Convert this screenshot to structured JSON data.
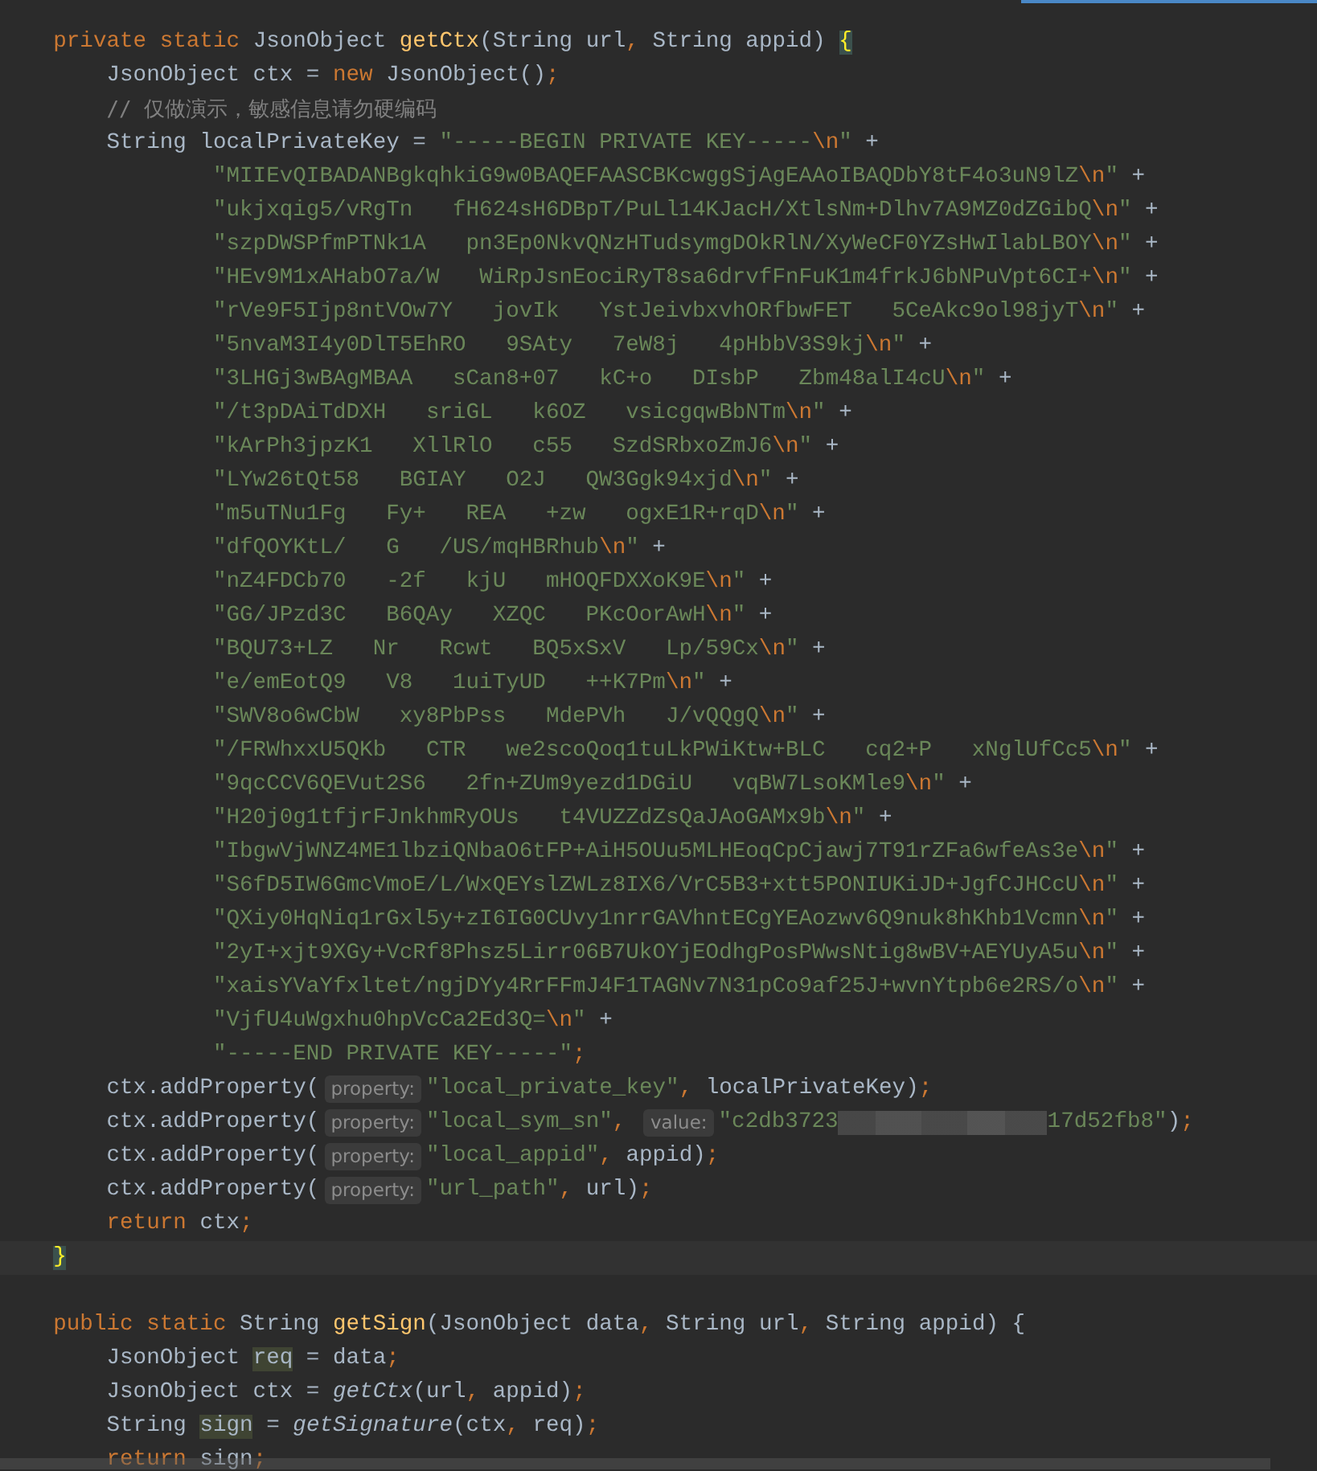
{
  "editor": {
    "lines": [
      {
        "kind": "code",
        "tokens": [
          {
            "kind": "keyword",
            "text": "private static "
          },
          {
            "kind": "plain",
            "text": "JsonObject "
          },
          {
            "kind": "method",
            "text": "getCtx"
          },
          {
            "kind": "plain",
            "text": "(String url"
          },
          {
            "kind": "punct",
            "text": ", "
          },
          {
            "kind": "plain",
            "text": "String appid) "
          },
          {
            "kind": "brace",
            "text": "{"
          }
        ],
        "children": [
          {
            "kind": "code",
            "tokens": [
              {
                "kind": "plain",
                "text": "JsonObject ctx = "
              },
              {
                "kind": "keyword",
                "text": "new "
              },
              {
                "kind": "plain",
                "text": "JsonObject()"
              },
              {
                "kind": "punct",
                "text": ";"
              }
            ]
          },
          {
            "kind": "code",
            "tokens": [
              {
                "kind": "comment",
                "text": "// 仅做演示，敏感信息请勿硬编码"
              }
            ]
          },
          {
            "kind": "code",
            "tokens": [
              {
                "kind": "plain",
                "text": "String localPrivateKey = "
              },
              {
                "kind": "string",
                "text": "\"-----BEGIN PRIVATE KEY-----"
              },
              {
                "kind": "escape",
                "text": "\\n"
              },
              {
                "kind": "string",
                "text": "\""
              },
              {
                "kind": "plain",
                "text": " +"
              }
            ],
            "continued": [
              {
                "kind": "code",
                "tokens": [
                  {
                    "kind": "string",
                    "text": "\"MIIEvQIBADANBgkqhkiG9w0BAQEFAASCBKcwggSjAgEAAoIBAQDbY8tF4o3uN9lZ"
                  },
                  {
                    "kind": "escape",
                    "text": "\\n"
                  },
                  {
                    "kind": "string",
                    "text": "\""
                  },
                  {
                    "kind": "plain",
                    "text": " +"
                  }
                ]
              },
              {
                "kind": "code",
                "tokens": [
                  {
                    "kind": "string",
                    "text": "\"ukjxqig5/vRgTn"
                  },
                  {
                    "kind": "gap"
                  },
                  {
                    "kind": "string",
                    "text": "fH624sH6DBpT/PuLl14KJacH/XtlsNm+Dlhv7A9MZ0dZGibQ"
                  },
                  {
                    "kind": "escape",
                    "text": "\\n"
                  },
                  {
                    "kind": "string",
                    "text": "\""
                  },
                  {
                    "kind": "plain",
                    "text": " +"
                  }
                ]
              },
              {
                "kind": "code",
                "tokens": [
                  {
                    "kind": "string",
                    "text": "\"szpDWSPfmPTNk1A"
                  },
                  {
                    "kind": "gap"
                  },
                  {
                    "kind": "string",
                    "text": "pn3Ep0NkvQNzHTudsymgDOkRlN/XyWeCF0YZsHwIlabLBOY"
                  },
                  {
                    "kind": "escape",
                    "text": "\\n"
                  },
                  {
                    "kind": "string",
                    "text": "\""
                  },
                  {
                    "kind": "plain",
                    "text": " +"
                  }
                ]
              },
              {
                "kind": "code",
                "tokens": [
                  {
                    "kind": "string",
                    "text": "\"HEv9M1xAHabO7a/W"
                  },
                  {
                    "kind": "gap"
                  },
                  {
                    "kind": "string",
                    "text": "WiRpJsnEociRyT8sa6drvfFnFuK1m4frkJ6bNPuVpt6CI+"
                  },
                  {
                    "kind": "escape",
                    "text": "\\n"
                  },
                  {
                    "kind": "string",
                    "text": "\""
                  },
                  {
                    "kind": "plain",
                    "text": " +"
                  }
                ]
              },
              {
                "kind": "code",
                "tokens": [
                  {
                    "kind": "string",
                    "text": "\"rVe9F5Ijp8ntVOw7Y"
                  },
                  {
                    "kind": "gap"
                  },
                  {
                    "kind": "string",
                    "text": "jovIk"
                  },
                  {
                    "kind": "gap"
                  },
                  {
                    "kind": "string",
                    "text": "YstJeivbxvhORfbwFET"
                  },
                  {
                    "kind": "gap"
                  },
                  {
                    "kind": "string",
                    "text": "5CeAkc9ol98jyT"
                  },
                  {
                    "kind": "escape",
                    "text": "\\n"
                  },
                  {
                    "kind": "string",
                    "text": "\""
                  },
                  {
                    "kind": "plain",
                    "text": " +"
                  }
                ]
              },
              {
                "kind": "code",
                "tokens": [
                  {
                    "kind": "string",
                    "text": "\"5nvaM3I4y0DlT5EhRO"
                  },
                  {
                    "kind": "gap"
                  },
                  {
                    "kind": "string",
                    "text": "9SAty"
                  },
                  {
                    "kind": "gap"
                  },
                  {
                    "kind": "string",
                    "text": "7eW8j"
                  },
                  {
                    "kind": "gap"
                  },
                  {
                    "kind": "string",
                    "text": "4pHbbV3S9kj"
                  },
                  {
                    "kind": "escape",
                    "text": "\\n"
                  },
                  {
                    "kind": "string",
                    "text": "\""
                  },
                  {
                    "kind": "plain",
                    "text": " +"
                  }
                ]
              },
              {
                "kind": "code",
                "tokens": [
                  {
                    "kind": "string",
                    "text": "\"3LHGj3wBAgMBAA"
                  },
                  {
                    "kind": "gap"
                  },
                  {
                    "kind": "string",
                    "text": "sCan8+07"
                  },
                  {
                    "kind": "gap"
                  },
                  {
                    "kind": "string",
                    "text": "kC+o"
                  },
                  {
                    "kind": "gap"
                  },
                  {
                    "kind": "string",
                    "text": "DIsbP"
                  },
                  {
                    "kind": "gap"
                  },
                  {
                    "kind": "string",
                    "text": "Zbm48alI4cU"
                  },
                  {
                    "kind": "escape",
                    "text": "\\n"
                  },
                  {
                    "kind": "string",
                    "text": "\""
                  },
                  {
                    "kind": "plain",
                    "text": " +"
                  }
                ]
              },
              {
                "kind": "code",
                "tokens": [
                  {
                    "kind": "string",
                    "text": "\"/t3pDAiTdDXH"
                  },
                  {
                    "kind": "gap"
                  },
                  {
                    "kind": "string",
                    "text": "sriGL"
                  },
                  {
                    "kind": "gap"
                  },
                  {
                    "kind": "string",
                    "text": "k6OZ"
                  },
                  {
                    "kind": "gap"
                  },
                  {
                    "kind": "string",
                    "text": "vsicgqwBbNTm"
                  },
                  {
                    "kind": "escape",
                    "text": "\\n"
                  },
                  {
                    "kind": "string",
                    "text": "\""
                  },
                  {
                    "kind": "plain",
                    "text": " +"
                  }
                ]
              },
              {
                "kind": "code",
                "tokens": [
                  {
                    "kind": "string",
                    "text": "\"kArPh3jpzK1"
                  },
                  {
                    "kind": "gap"
                  },
                  {
                    "kind": "string",
                    "text": "XllRlO"
                  },
                  {
                    "kind": "gap"
                  },
                  {
                    "kind": "string",
                    "text": "c55"
                  },
                  {
                    "kind": "gap"
                  },
                  {
                    "kind": "string",
                    "text": "SzdSRbxoZmJ6"
                  },
                  {
                    "kind": "escape",
                    "text": "\\n"
                  },
                  {
                    "kind": "string",
                    "text": "\""
                  },
                  {
                    "kind": "plain",
                    "text": " +"
                  }
                ]
              },
              {
                "kind": "code",
                "tokens": [
                  {
                    "kind": "string",
                    "text": "\"LYw26tQt58"
                  },
                  {
                    "kind": "gap"
                  },
                  {
                    "kind": "string",
                    "text": "BGIAY"
                  },
                  {
                    "kind": "gap"
                  },
                  {
                    "kind": "string",
                    "text": "O2J"
                  },
                  {
                    "kind": "gap"
                  },
                  {
                    "kind": "string",
                    "text": "QW3Ggk94xjd"
                  },
                  {
                    "kind": "escape",
                    "text": "\\n"
                  },
                  {
                    "kind": "string",
                    "text": "\""
                  },
                  {
                    "kind": "plain",
                    "text": " +"
                  }
                ]
              },
              {
                "kind": "code",
                "tokens": [
                  {
                    "kind": "string",
                    "text": "\"m5uTNu1Fg"
                  },
                  {
                    "kind": "gap"
                  },
                  {
                    "kind": "string",
                    "text": "Fy+"
                  },
                  {
                    "kind": "gap"
                  },
                  {
                    "kind": "string",
                    "text": "REA"
                  },
                  {
                    "kind": "gap"
                  },
                  {
                    "kind": "string",
                    "text": "+zw"
                  },
                  {
                    "kind": "gap"
                  },
                  {
                    "kind": "string",
                    "text": "ogxE1R+rqD"
                  },
                  {
                    "kind": "escape",
                    "text": "\\n"
                  },
                  {
                    "kind": "string",
                    "text": "\""
                  },
                  {
                    "kind": "plain",
                    "text": " +"
                  }
                ]
              },
              {
                "kind": "code",
                "tokens": [
                  {
                    "kind": "string",
                    "text": "\"dfQOYKtL/"
                  },
                  {
                    "kind": "gap"
                  },
                  {
                    "kind": "string",
                    "text": "G"
                  },
                  {
                    "kind": "gap"
                  },
                  {
                    "kind": "string",
                    "text": "/US/mqHBRhub"
                  },
                  {
                    "kind": "escape",
                    "text": "\\n"
                  },
                  {
                    "kind": "string",
                    "text": "\""
                  },
                  {
                    "kind": "plain",
                    "text": " +"
                  }
                ]
              },
              {
                "kind": "code",
                "tokens": [
                  {
                    "kind": "string",
                    "text": "\"nZ4FDCb70"
                  },
                  {
                    "kind": "gap"
                  },
                  {
                    "kind": "string",
                    "text": "-2f"
                  },
                  {
                    "kind": "gap"
                  },
                  {
                    "kind": "string",
                    "text": "kjU"
                  },
                  {
                    "kind": "gap"
                  },
                  {
                    "kind": "string",
                    "text": "mHOQFDXXoK9E"
                  },
                  {
                    "kind": "escape",
                    "text": "\\n"
                  },
                  {
                    "kind": "string",
                    "text": "\""
                  },
                  {
                    "kind": "plain",
                    "text": " +"
                  }
                ]
              },
              {
                "kind": "code",
                "tokens": [
                  {
                    "kind": "string",
                    "text": "\"GG/JPzd3C"
                  },
                  {
                    "kind": "gap"
                  },
                  {
                    "kind": "string",
                    "text": "B6QAy"
                  },
                  {
                    "kind": "gap"
                  },
                  {
                    "kind": "string",
                    "text": "XZQC"
                  },
                  {
                    "kind": "gap"
                  },
                  {
                    "kind": "string",
                    "text": "PKcOorAwH"
                  },
                  {
                    "kind": "escape",
                    "text": "\\n"
                  },
                  {
                    "kind": "string",
                    "text": "\""
                  },
                  {
                    "kind": "plain",
                    "text": " +"
                  }
                ]
              },
              {
                "kind": "code",
                "tokens": [
                  {
                    "kind": "string",
                    "text": "\"BQU73+LZ"
                  },
                  {
                    "kind": "gap"
                  },
                  {
                    "kind": "string",
                    "text": "Nr"
                  },
                  {
                    "kind": "gap"
                  },
                  {
                    "kind": "string",
                    "text": "Rcwt"
                  },
                  {
                    "kind": "gap"
                  },
                  {
                    "kind": "string",
                    "text": "BQ5xSxV"
                  },
                  {
                    "kind": "gap"
                  },
                  {
                    "kind": "string",
                    "text": "Lp/59Cx"
                  },
                  {
                    "kind": "escape",
                    "text": "\\n"
                  },
                  {
                    "kind": "string",
                    "text": "\""
                  },
                  {
                    "kind": "plain",
                    "text": " +"
                  }
                ]
              },
              {
                "kind": "code",
                "tokens": [
                  {
                    "kind": "string",
                    "text": "\"e/emEotQ9"
                  },
                  {
                    "kind": "gap"
                  },
                  {
                    "kind": "string",
                    "text": "V8"
                  },
                  {
                    "kind": "gap"
                  },
                  {
                    "kind": "string",
                    "text": "1uiTyUD"
                  },
                  {
                    "kind": "gap"
                  },
                  {
                    "kind": "string",
                    "text": "++K7Pm"
                  },
                  {
                    "kind": "escape",
                    "text": "\\n"
                  },
                  {
                    "kind": "string",
                    "text": "\""
                  },
                  {
                    "kind": "plain",
                    "text": " +"
                  }
                ]
              },
              {
                "kind": "code",
                "tokens": [
                  {
                    "kind": "string",
                    "text": "\"SWV8o6wCbW"
                  },
                  {
                    "kind": "gap"
                  },
                  {
                    "kind": "string",
                    "text": "xy8PbPss"
                  },
                  {
                    "kind": "gap"
                  },
                  {
                    "kind": "string",
                    "text": "MdePVh"
                  },
                  {
                    "kind": "gap"
                  },
                  {
                    "kind": "string",
                    "text": "J/vQQgQ"
                  },
                  {
                    "kind": "escape",
                    "text": "\\n"
                  },
                  {
                    "kind": "string",
                    "text": "\""
                  },
                  {
                    "kind": "plain",
                    "text": " +"
                  }
                ]
              },
              {
                "kind": "code",
                "tokens": [
                  {
                    "kind": "string",
                    "text": "\"/FRWhxxU5QKb"
                  },
                  {
                    "kind": "gap"
                  },
                  {
                    "kind": "string",
                    "text": "CTR"
                  },
                  {
                    "kind": "gap"
                  },
                  {
                    "kind": "string",
                    "text": "we2scoQoq1tuLkPWiKtw+BLC"
                  },
                  {
                    "kind": "gap"
                  },
                  {
                    "kind": "string",
                    "text": "cq2+P"
                  },
                  {
                    "kind": "gap"
                  },
                  {
                    "kind": "string",
                    "text": "xNglUfCc5"
                  },
                  {
                    "kind": "escape",
                    "text": "\\n"
                  },
                  {
                    "kind": "string",
                    "text": "\""
                  },
                  {
                    "kind": "plain",
                    "text": " +"
                  }
                ]
              },
              {
                "kind": "code",
                "tokens": [
                  {
                    "kind": "string",
                    "text": "\"9qcCCV6QEVut2S6"
                  },
                  {
                    "kind": "gap"
                  },
                  {
                    "kind": "string",
                    "text": "2fn+ZUm9yezd1DGiU"
                  },
                  {
                    "kind": "gap"
                  },
                  {
                    "kind": "string",
                    "text": "vqBW7LsoKMle9"
                  },
                  {
                    "kind": "escape",
                    "text": "\\n"
                  },
                  {
                    "kind": "string",
                    "text": "\""
                  },
                  {
                    "kind": "plain",
                    "text": " +"
                  }
                ]
              },
              {
                "kind": "code",
                "tokens": [
                  {
                    "kind": "string",
                    "text": "\"H20j0g1tfjrFJnkhmRyOUs"
                  },
                  {
                    "kind": "gap"
                  },
                  {
                    "kind": "string",
                    "text": "t4VUZZdZsQaJAoGAMx9b"
                  },
                  {
                    "kind": "escape",
                    "text": "\\n"
                  },
                  {
                    "kind": "string",
                    "text": "\""
                  },
                  {
                    "kind": "plain",
                    "text": " +"
                  }
                ]
              },
              {
                "kind": "code",
                "tokens": [
                  {
                    "kind": "string",
                    "text": "\"IbgwVjWNZ4ME1lbziQNbaO6tFP+AiH5OUu5MLHEoqCpCjawj7T91rZFa6wfeAs3e"
                  },
                  {
                    "kind": "escape",
                    "text": "\\n"
                  },
                  {
                    "kind": "string",
                    "text": "\""
                  },
                  {
                    "kind": "plain",
                    "text": " +"
                  }
                ]
              },
              {
                "kind": "code",
                "tokens": [
                  {
                    "kind": "string",
                    "text": "\"S6fD5IW6GmcVmoE/L/WxQEYslZWLz8IX6/VrC5B3+xtt5PONIUKiJD+JgfCJHCcU"
                  },
                  {
                    "kind": "escape",
                    "text": "\\n"
                  },
                  {
                    "kind": "string",
                    "text": "\""
                  },
                  {
                    "kind": "plain",
                    "text": " +"
                  }
                ]
              },
              {
                "kind": "code",
                "tokens": [
                  {
                    "kind": "string",
                    "text": "\"QXiy0HqNiq1rGxl5y+zI6IG0CUvy1nrrGAVhntECgYEAozwv6Q9nuk8hKhb1Vcmn"
                  },
                  {
                    "kind": "escape",
                    "text": "\\n"
                  },
                  {
                    "kind": "string",
                    "text": "\""
                  },
                  {
                    "kind": "plain",
                    "text": " +"
                  }
                ]
              },
              {
                "kind": "code",
                "tokens": [
                  {
                    "kind": "string",
                    "text": "\"2yI+xjt9XGy+VcRf8Phsz5Lirr06B7UkOYjEOdhgPosPWwsNtig8wBV+AEYUyA5u"
                  },
                  {
                    "kind": "escape",
                    "text": "\\n"
                  },
                  {
                    "kind": "string",
                    "text": "\""
                  },
                  {
                    "kind": "plain",
                    "text": " +"
                  }
                ]
              },
              {
                "kind": "code",
                "tokens": [
                  {
                    "kind": "string",
                    "text": "\"xaisYVaYfxltet/ngjDYy4RrFFmJ4F1TAGNv7N31pCo9af25J+wvnYtpb6e2RS/o"
                  },
                  {
                    "kind": "escape",
                    "text": "\\n"
                  },
                  {
                    "kind": "string",
                    "text": "\""
                  },
                  {
                    "kind": "plain",
                    "text": " +"
                  }
                ]
              },
              {
                "kind": "code",
                "tokens": [
                  {
                    "kind": "string",
                    "text": "\"VjfU4uWgxhu0hpVcCa2Ed3Q="
                  },
                  {
                    "kind": "escape",
                    "text": "\\n"
                  },
                  {
                    "kind": "string",
                    "text": "\""
                  },
                  {
                    "kind": "plain",
                    "text": " +"
                  }
                ]
              },
              {
                "kind": "code",
                "tokens": [
                  {
                    "kind": "string",
                    "text": "\"-----END PRIVATE KEY-----\""
                  },
                  {
                    "kind": "punct",
                    "text": ";"
                  }
                ]
              }
            ]
          },
          {
            "kind": "code",
            "tokens": [
              {
                "kind": "plain",
                "text": "ctx.addProperty("
              },
              {
                "kind": "hint",
                "text": "property:"
              },
              {
                "kind": "string",
                "text": "\"local_private_key\""
              },
              {
                "kind": "punct",
                "text": ", "
              },
              {
                "kind": "plain",
                "text": "localPrivateKey)"
              },
              {
                "kind": "punct",
                "text": ";"
              }
            ]
          },
          {
            "kind": "code",
            "tokens": [
              {
                "kind": "plain",
                "text": "ctx.addProperty("
              },
              {
                "kind": "hint",
                "text": "property:"
              },
              {
                "kind": "string",
                "text": "\"local_sym_sn\""
              },
              {
                "kind": "punct",
                "text": ", "
              },
              {
                "kind": "hint",
                "text": "value:"
              },
              {
                "kind": "string",
                "text": "\"c2db3723"
              },
              {
                "kind": "redacted"
              },
              {
                "kind": "string",
                "text": "17d52fb8\""
              },
              {
                "kind": "plain",
                "text": ")"
              },
              {
                "kind": "punct",
                "text": ";"
              }
            ]
          },
          {
            "kind": "code",
            "tokens": [
              {
                "kind": "plain",
                "text": "ctx.addProperty("
              },
              {
                "kind": "hint",
                "text": "property:"
              },
              {
                "kind": "string",
                "text": "\"local_appid\""
              },
              {
                "kind": "punct",
                "text": ", "
              },
              {
                "kind": "plain",
                "text": "appid)"
              },
              {
                "kind": "punct",
                "text": ";"
              }
            ]
          },
          {
            "kind": "code",
            "tokens": [
              {
                "kind": "plain",
                "text": "ctx.addProperty("
              },
              {
                "kind": "hint",
                "text": "property:"
              },
              {
                "kind": "string",
                "text": "\"url_path\""
              },
              {
                "kind": "punct",
                "text": ", "
              },
              {
                "kind": "plain",
                "text": "url)"
              },
              {
                "kind": "punct",
                "text": ";"
              }
            ]
          },
          {
            "kind": "code",
            "tokens": [
              {
                "kind": "keyword",
                "text": "return "
              },
              {
                "kind": "plain",
                "text": "ctx"
              },
              {
                "kind": "punct",
                "text": ";"
              }
            ]
          }
        ]
      },
      {
        "kind": "caret",
        "tokens": [
          {
            "kind": "brace",
            "text": "}"
          }
        ]
      },
      {
        "kind": "blank"
      },
      {
        "kind": "code",
        "tokens": [
          {
            "kind": "keyword",
            "text": "public static "
          },
          {
            "kind": "plain",
            "text": "String "
          },
          {
            "kind": "method",
            "text": "getSign"
          },
          {
            "kind": "plain",
            "text": "(JsonObject data"
          },
          {
            "kind": "punct",
            "text": ", "
          },
          {
            "kind": "plain",
            "text": "String url"
          },
          {
            "kind": "punct",
            "text": ", "
          },
          {
            "kind": "plain",
            "text": "String appid) {"
          }
        ],
        "children": [
          {
            "kind": "code",
            "tokens": [
              {
                "kind": "plain",
                "text": "JsonObject "
              },
              {
                "kind": "usage",
                "text": "req"
              },
              {
                "kind": "plain",
                "text": " = data"
              },
              {
                "kind": "punct",
                "text": ";"
              }
            ]
          },
          {
            "kind": "code",
            "tokens": [
              {
                "kind": "plain",
                "text": "JsonObject ctx = "
              },
              {
                "kind": "call",
                "text": "getCtx"
              },
              {
                "kind": "plain",
                "text": "(url"
              },
              {
                "kind": "punct",
                "text": ", "
              },
              {
                "kind": "plain",
                "text": "appid)"
              },
              {
                "kind": "punct",
                "text": ";"
              }
            ]
          },
          {
            "kind": "code",
            "tokens": [
              {
                "kind": "plain",
                "text": "String "
              },
              {
                "kind": "usage",
                "text": "sign"
              },
              {
                "kind": "plain",
                "text": " = "
              },
              {
                "kind": "call",
                "text": "getSignature"
              },
              {
                "kind": "plain",
                "text": "(ctx"
              },
              {
                "kind": "punct",
                "text": ", "
              },
              {
                "kind": "plain",
                "text": "req)"
              },
              {
                "kind": "punct",
                "text": ";"
              }
            ]
          },
          {
            "kind": "code",
            "tokens": [
              {
                "kind": "keyword",
                "text": "return "
              },
              {
                "kind": "plain",
                "text": "sign"
              },
              {
                "kind": "punct",
                "text": ";"
              }
            ]
          }
        ]
      }
    ]
  }
}
